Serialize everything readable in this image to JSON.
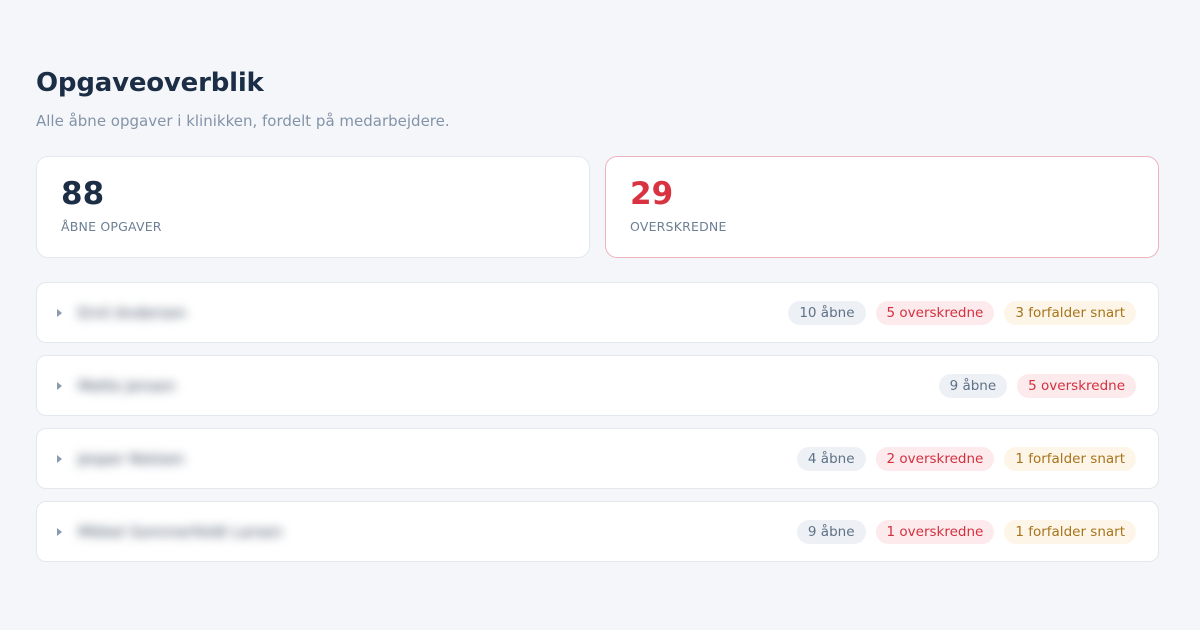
{
  "header": {
    "title": "Opgaveoverblik",
    "subtitle": "Alle åbne opgaver i klinikken, fordelt på medarbejdere."
  },
  "stats": [
    {
      "value": "88",
      "label": "ÅBNE OPGAVER",
      "accent": "#1b2e45"
    },
    {
      "value": "29",
      "label": "OVERSKREDNE",
      "accent": "#d93240"
    }
  ],
  "rows": [
    {
      "name": "Emil Andersen",
      "open": "10 åbne",
      "overdue": "5 overskredne",
      "soon": "3 forfalder snart"
    },
    {
      "name": "Mette Jensen",
      "open": "9 åbne",
      "overdue": "5 overskredne",
      "soon": null
    },
    {
      "name": "Jesper Nielsen",
      "open": "4 åbne",
      "overdue": "2 overskredne",
      "soon": "1 forfalder snart"
    },
    {
      "name": "Mikkel Sommerfeldt Larsen",
      "open": "9 åbne",
      "overdue": "1 overskredne",
      "soon": "1 forfalder snart"
    }
  ],
  "icons": {
    "row_toggle": "chevron-right-icon"
  },
  "colors": {
    "background": "#f5f6fa",
    "overdue": "#d93240",
    "soon": "#a8731b",
    "open": "#5f7186"
  }
}
